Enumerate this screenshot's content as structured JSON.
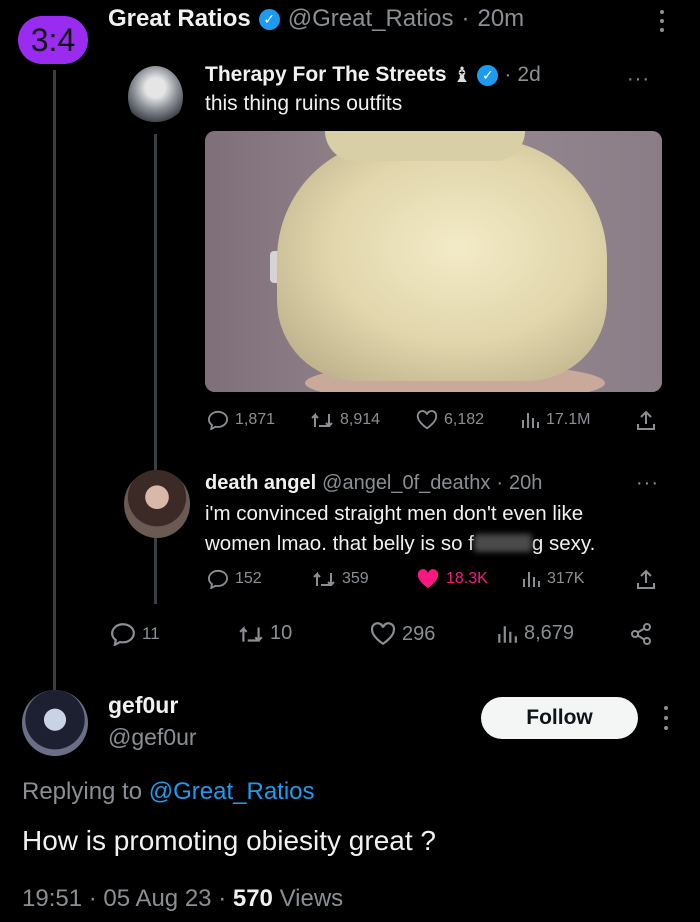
{
  "top_tweet": {
    "avatar_text": "3:4",
    "name": "Great Ratios",
    "handle": "@Great_Ratios",
    "time": "20m",
    "actions": {
      "replies": "11",
      "retweets": "10",
      "likes": "296",
      "views": "8,679"
    }
  },
  "quote1": {
    "name": "Therapy For The Streets",
    "emoji": "♝",
    "time": "2d",
    "text": "this thing ruins outfits",
    "stats": {
      "replies": "1,871",
      "retweets": "8,914",
      "likes": "6,182",
      "views": "17.1M"
    }
  },
  "quote2": {
    "name": "death angel",
    "handle": "@angel_0f_deathx",
    "time": "20h",
    "text_line1": "i'm convinced straight men don't even like",
    "text_line2_a": "women lmao. that belly is so f",
    "text_line2_b": "g sexy.",
    "stats": {
      "replies": "152",
      "retweets": "359",
      "likes": "18.3K",
      "views": "317K"
    },
    "liked_color": "#f91880"
  },
  "reply": {
    "name": "gef0ur",
    "handle": "@gef0ur",
    "follow_label": "Follow",
    "replying_prefix": "Replying to",
    "replying_handle": "@Great_Ratios",
    "text": "How is promoting obiesity great ?",
    "time": "19:51",
    "date": "05 Aug 23",
    "views_count": "570",
    "views_label": "Views"
  },
  "icons": [
    "reply-icon",
    "retweet-icon",
    "like-icon",
    "views-icon",
    "share-icon",
    "verified-icon",
    "more-icon"
  ]
}
